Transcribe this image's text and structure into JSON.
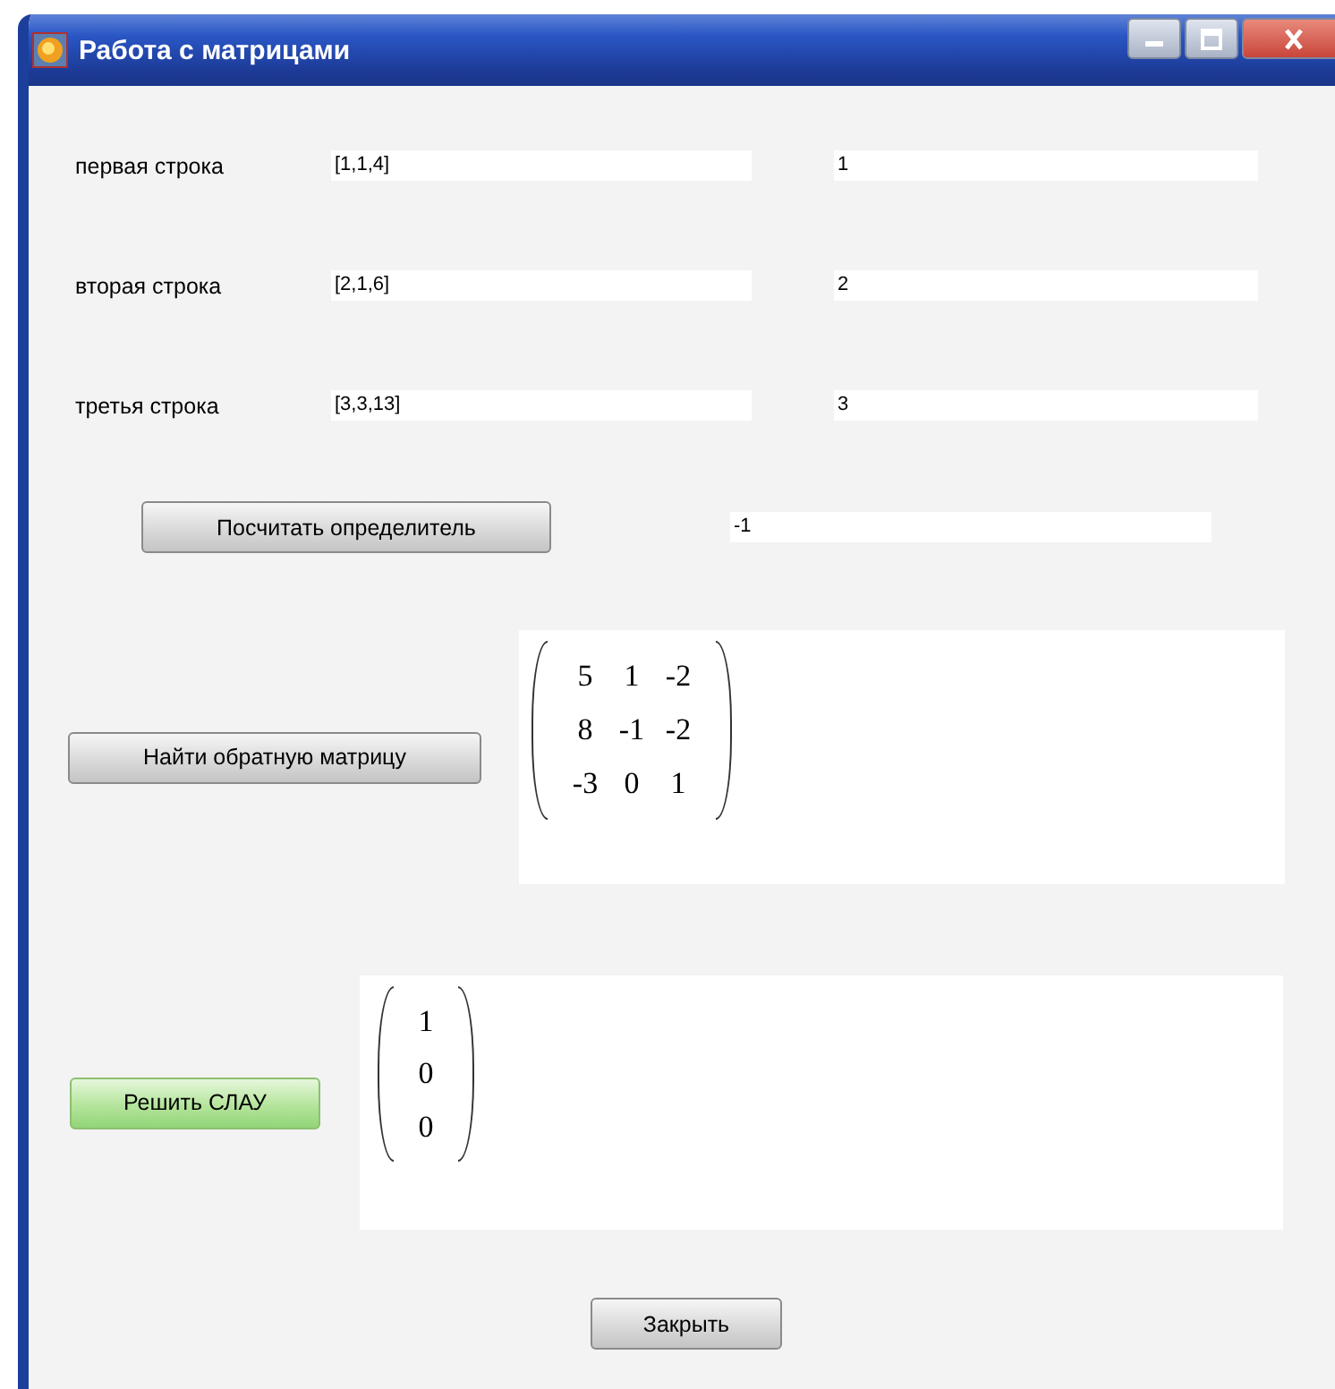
{
  "window": {
    "title": "Работа с матрицами"
  },
  "rows": [
    {
      "label": "первая строка",
      "coefficients": "[1,1,4]",
      "free_term": "1"
    },
    {
      "label": "вторая строка",
      "coefficients": "[2,1,6]",
      "free_term": "2"
    },
    {
      "label": "третья строка",
      "coefficients": "[3,3,13]",
      "free_term": "3"
    }
  ],
  "determinant": {
    "button": {
      "label": "Посчитать определитель",
      "highlighted": false
    },
    "value": "-1"
  },
  "inverse": {
    "button": {
      "label": "Найти обратную матрицу",
      "highlighted": false
    },
    "matrix": [
      [
        "5",
        "1",
        "-2"
      ],
      [
        "8",
        "-1",
        "-2"
      ],
      [
        "-3",
        "0",
        "1"
      ]
    ]
  },
  "system": {
    "button": {
      "label": "Решить СЛАУ",
      "highlighted": true
    },
    "solution": [
      "1",
      "0",
      "0"
    ]
  },
  "close_button": {
    "label": "Закрыть",
    "highlighted": false
  }
}
